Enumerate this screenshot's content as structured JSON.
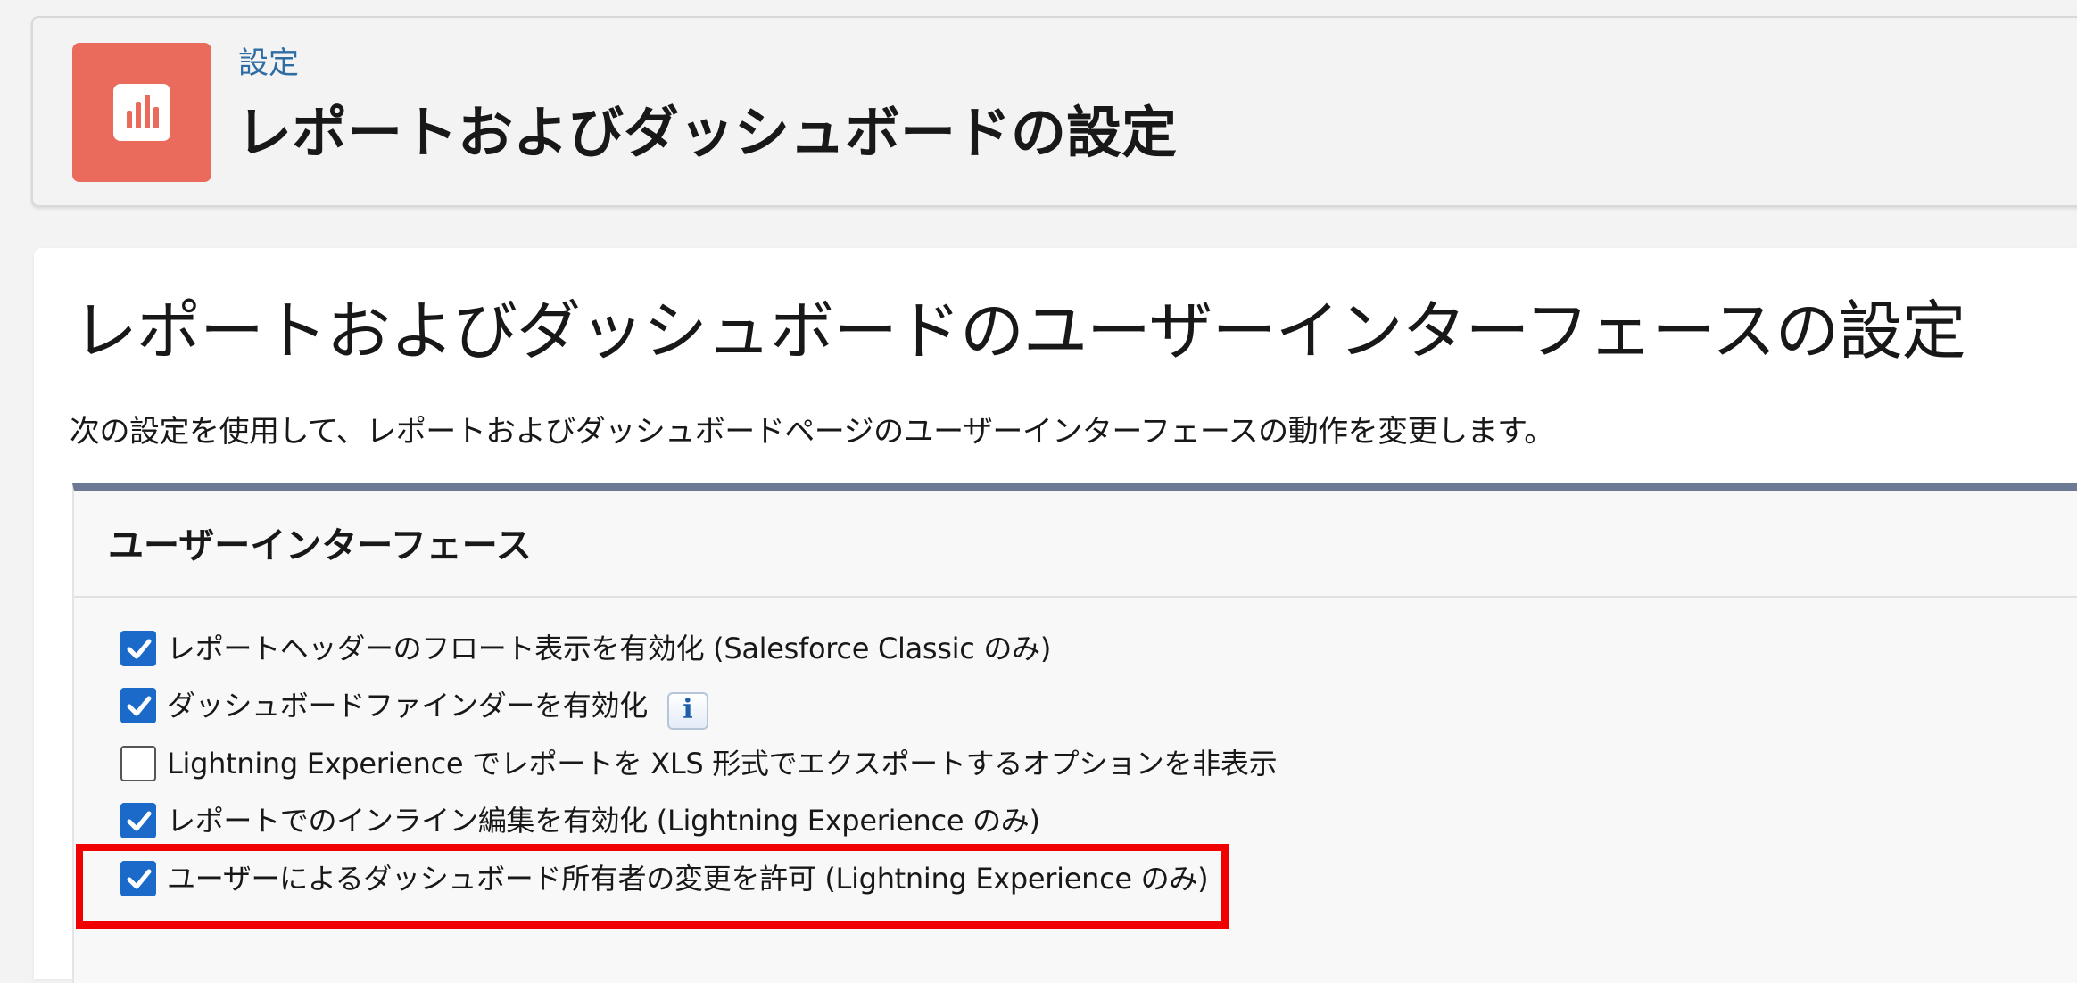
{
  "header": {
    "breadcrumb": "設定",
    "title": "レポートおよびダッシュボードの設定",
    "icon": "report-chart-icon",
    "icon_color": "#ea6a5b"
  },
  "section": {
    "title": "レポートおよびダッシュボードのユーザーインターフェースの設定",
    "description": "次の設定を使用して、レポートおよびダッシュボードページのユーザーインターフェースの動作を変更します。"
  },
  "panel": {
    "title": "ユーザーインターフェース",
    "options": [
      {
        "label": "レポートヘッダーのフロート表示を有効化 (Salesforce Classic のみ)",
        "checked": true
      },
      {
        "label": "ダッシュボードファインダーを有効化",
        "checked": true,
        "info_icon": "i"
      },
      {
        "label": "Lightning Experience でレポートを XLS 形式でエクスポートするオプションを非表示",
        "checked": false
      },
      {
        "label": "レポートでのインライン編集を有効化 (Lightning Experience のみ)",
        "checked": true
      },
      {
        "label": "ユーザーによるダッシュボード所有者の変更を許可 (Lightning Experience のみ)",
        "checked": true,
        "highlighted": true
      }
    ]
  },
  "colors": {
    "checkbox_checked": "#1b6ac9",
    "panel_top_border": "#6c7a96",
    "highlight_border": "#f00000",
    "breadcrumb_link": "#2e6da4"
  }
}
